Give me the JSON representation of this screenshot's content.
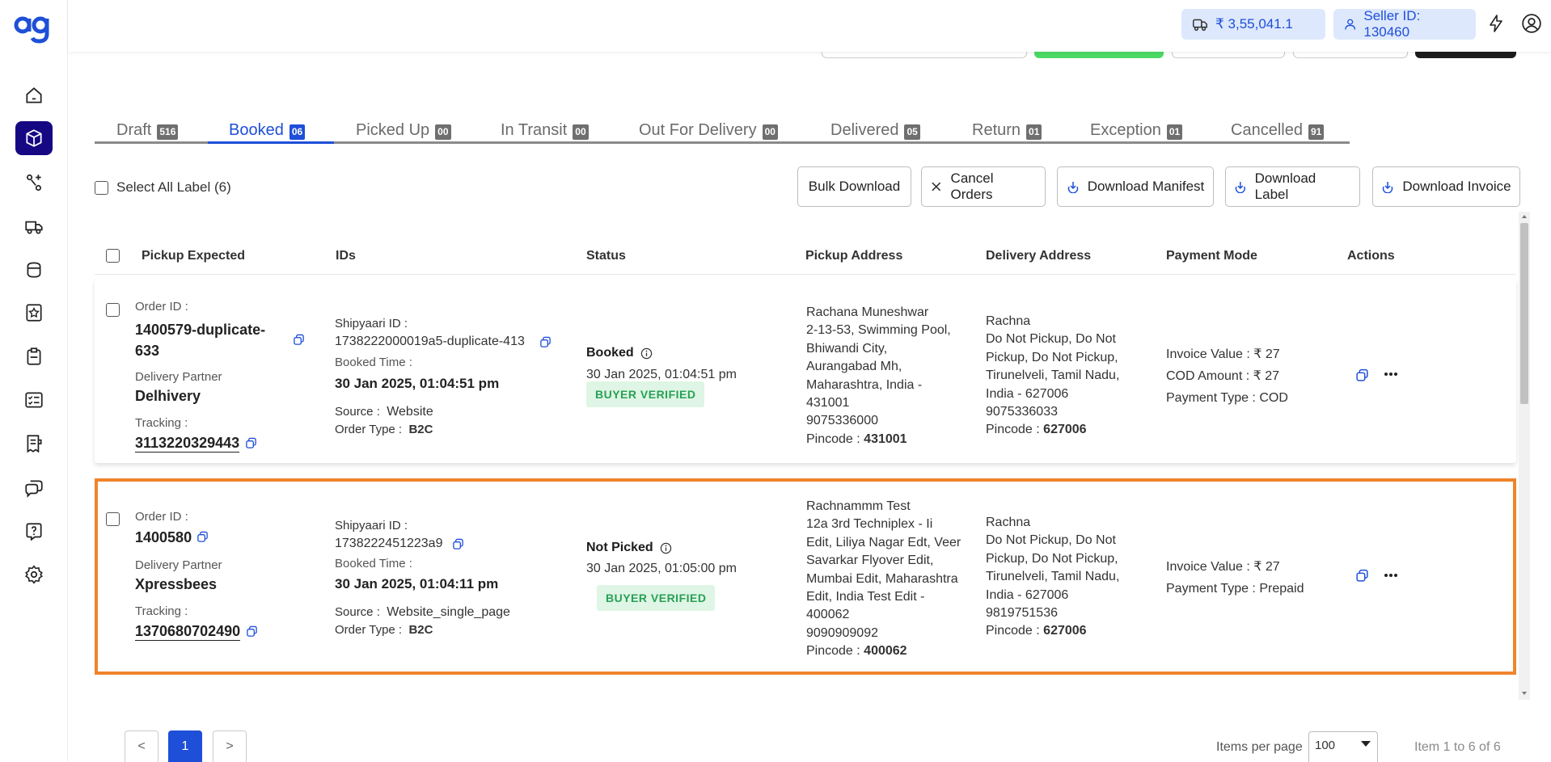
{
  "brand": {
    "logo_text": "ag",
    "accent": "#160783",
    "primary": "#1e4fd8",
    "highlight": "#f0842c"
  },
  "sidebar": {
    "items": [
      {
        "icon": "home-icon"
      },
      {
        "icon": "box-icon",
        "active": true
      },
      {
        "icon": "route-icon"
      },
      {
        "icon": "truck-icon"
      },
      {
        "icon": "wallet-icon"
      },
      {
        "icon": "badge-icon"
      },
      {
        "icon": "clipboard-icon"
      },
      {
        "icon": "checklist-icon"
      },
      {
        "icon": "receipt-icon"
      },
      {
        "icon": "chat-icon"
      },
      {
        "icon": "help-icon"
      },
      {
        "icon": "settings-icon"
      }
    ]
  },
  "header": {
    "wallet_balance": "₹ 3,55,041.1",
    "seller_id": "Seller ID: 130460"
  },
  "tabs": [
    {
      "label": "Draft",
      "count": "516"
    },
    {
      "label": "Booked",
      "count": "06",
      "active": true
    },
    {
      "label": "Picked Up",
      "count": "00"
    },
    {
      "label": "In Transit",
      "count": "00"
    },
    {
      "label": "Out For Delivery",
      "count": "00"
    },
    {
      "label": "Delivered",
      "count": "05"
    },
    {
      "label": "Return",
      "count": "01"
    },
    {
      "label": "Exception",
      "count": "01"
    },
    {
      "label": "Cancelled",
      "count": "91"
    }
  ],
  "toolbar": {
    "select_all": "Select All Label (6)",
    "bulk_download": "Bulk Download",
    "cancel_orders": "Cancel Orders",
    "download_manifest": "Download Manifest",
    "download_label": "Download Label",
    "download_invoice": "Download Invoice"
  },
  "columns": [
    "Pickup Expected",
    "IDs",
    "Status",
    "Pickup Address",
    "Delivery Address",
    "Payment Mode",
    "Actions"
  ],
  "labels": {
    "order_id": "Order ID :",
    "delivery_partner": "Delivery Partner",
    "tracking": "Tracking :",
    "shipyaari_id": "Shipyaari ID :",
    "booked_time": "Booked Time :",
    "source": "Source :",
    "order_type": "Order Type :",
    "pincode": "Pincode :"
  },
  "orders": [
    {
      "order_id_line1": "1400579-duplicate-",
      "order_id_line2": "633",
      "partner": "Delhivery",
      "tracking": "3113220329443",
      "shipyaari_id": "1738222000019a5-duplicate-413",
      "booked_time": "30 Jan 2025, 01:04:51 pm",
      "source": "Website",
      "order_type": "B2C",
      "status": "Booked",
      "status_time": "30 Jan 2025, 01:04:51 pm",
      "verification": "BUYER VERIFIED",
      "pickup_address": [
        "Rachana Muneshwar",
        "2-13-53, Swimming Pool,",
        "Bhiwandi City,",
        "Aurangabad Mh,",
        "Maharashtra, India -",
        "431001",
        "9075336000"
      ],
      "pickup_pincode": "431001",
      "delivery_address": [
        "Rachna",
        "Do Not Pickup, Do Not",
        "Pickup, Do Not Pickup,",
        "Tirunelveli, Tamil Nadu,",
        "India - 627006",
        "9075336033"
      ],
      "delivery_pincode": "627006",
      "payment": [
        "Invoice Value : ₹ 27",
        "COD Amount : ₹ 27",
        "Payment Type : COD"
      ]
    },
    {
      "order_id_line1": "1400580",
      "order_id_line2": "",
      "partner": "Xpressbees",
      "tracking": "1370680702490",
      "shipyaari_id": "1738222451223a9",
      "booked_time": "30 Jan 2025, 01:04:11 pm",
      "source": "Website_single_page",
      "order_type": "B2C",
      "status": "Not Picked",
      "status_time": "30 Jan 2025, 01:05:00 pm",
      "verification": "BUYER VERIFIED",
      "pickup_address": [
        "Rachnammm Test",
        "12a 3rd Techniplex - Ii",
        "Edit, Liliya Nagar Edt, Veer",
        "Savarkar Flyover Edit,",
        "Mumbai Edit, Maharashtra",
        "Edit, India Test Edit -",
        "400062",
        "9090909092"
      ],
      "pickup_pincode": "400062",
      "delivery_address": [
        "Rachna",
        "Do Not Pickup, Do Not",
        "Pickup, Do Not Pickup,",
        "Tirunelveli, Tamil Nadu,",
        "India - 627006",
        "9819751536"
      ],
      "delivery_pincode": "627006",
      "payment": [
        "Invoice Value : ₹ 27",
        "Payment Type : Prepaid"
      ]
    }
  ],
  "pagination": {
    "prev": "<",
    "current": "1",
    "next": ">",
    "items_per_page_label": "Items per page",
    "items_per_page_value": "100",
    "range": "Item 1 to 6 of 6"
  }
}
